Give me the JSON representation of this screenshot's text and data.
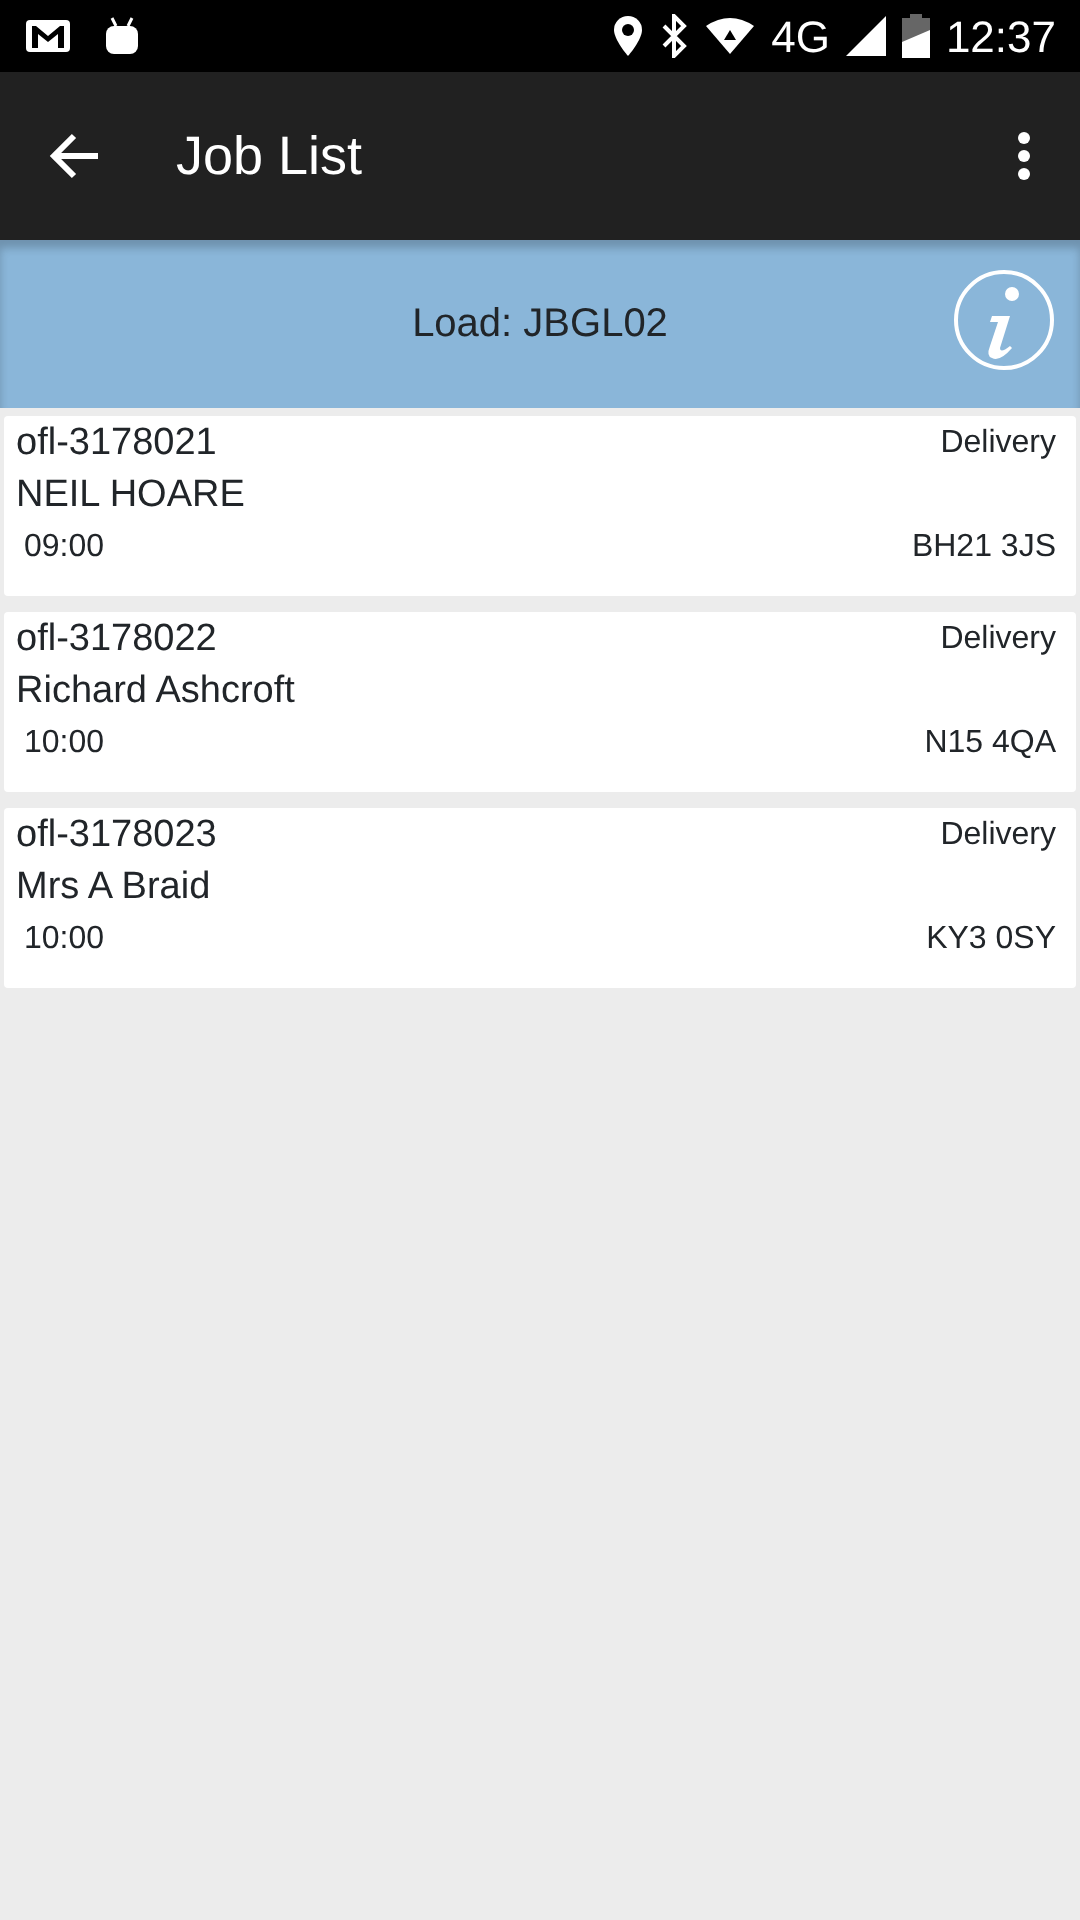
{
  "status_bar": {
    "network": "4G",
    "time": "12:37"
  },
  "toolbar": {
    "title": "Job List"
  },
  "load": {
    "label": "Load: JBGL02"
  },
  "jobs": [
    {
      "job_id": "ofl-3178021",
      "type": "Delivery",
      "customer": "NEIL HOARE",
      "time": "09:00",
      "postcode": "BH21 3JS"
    },
    {
      "job_id": "ofl-3178022",
      "type": "Delivery",
      "customer": "Richard Ashcroft",
      "time": "10:00",
      "postcode": "N15 4QA"
    },
    {
      "job_id": "ofl-3178023",
      "type": "Delivery",
      "customer": "Mrs A Braid",
      "time": "10:00",
      "postcode": "KY3 0SY"
    }
  ]
}
